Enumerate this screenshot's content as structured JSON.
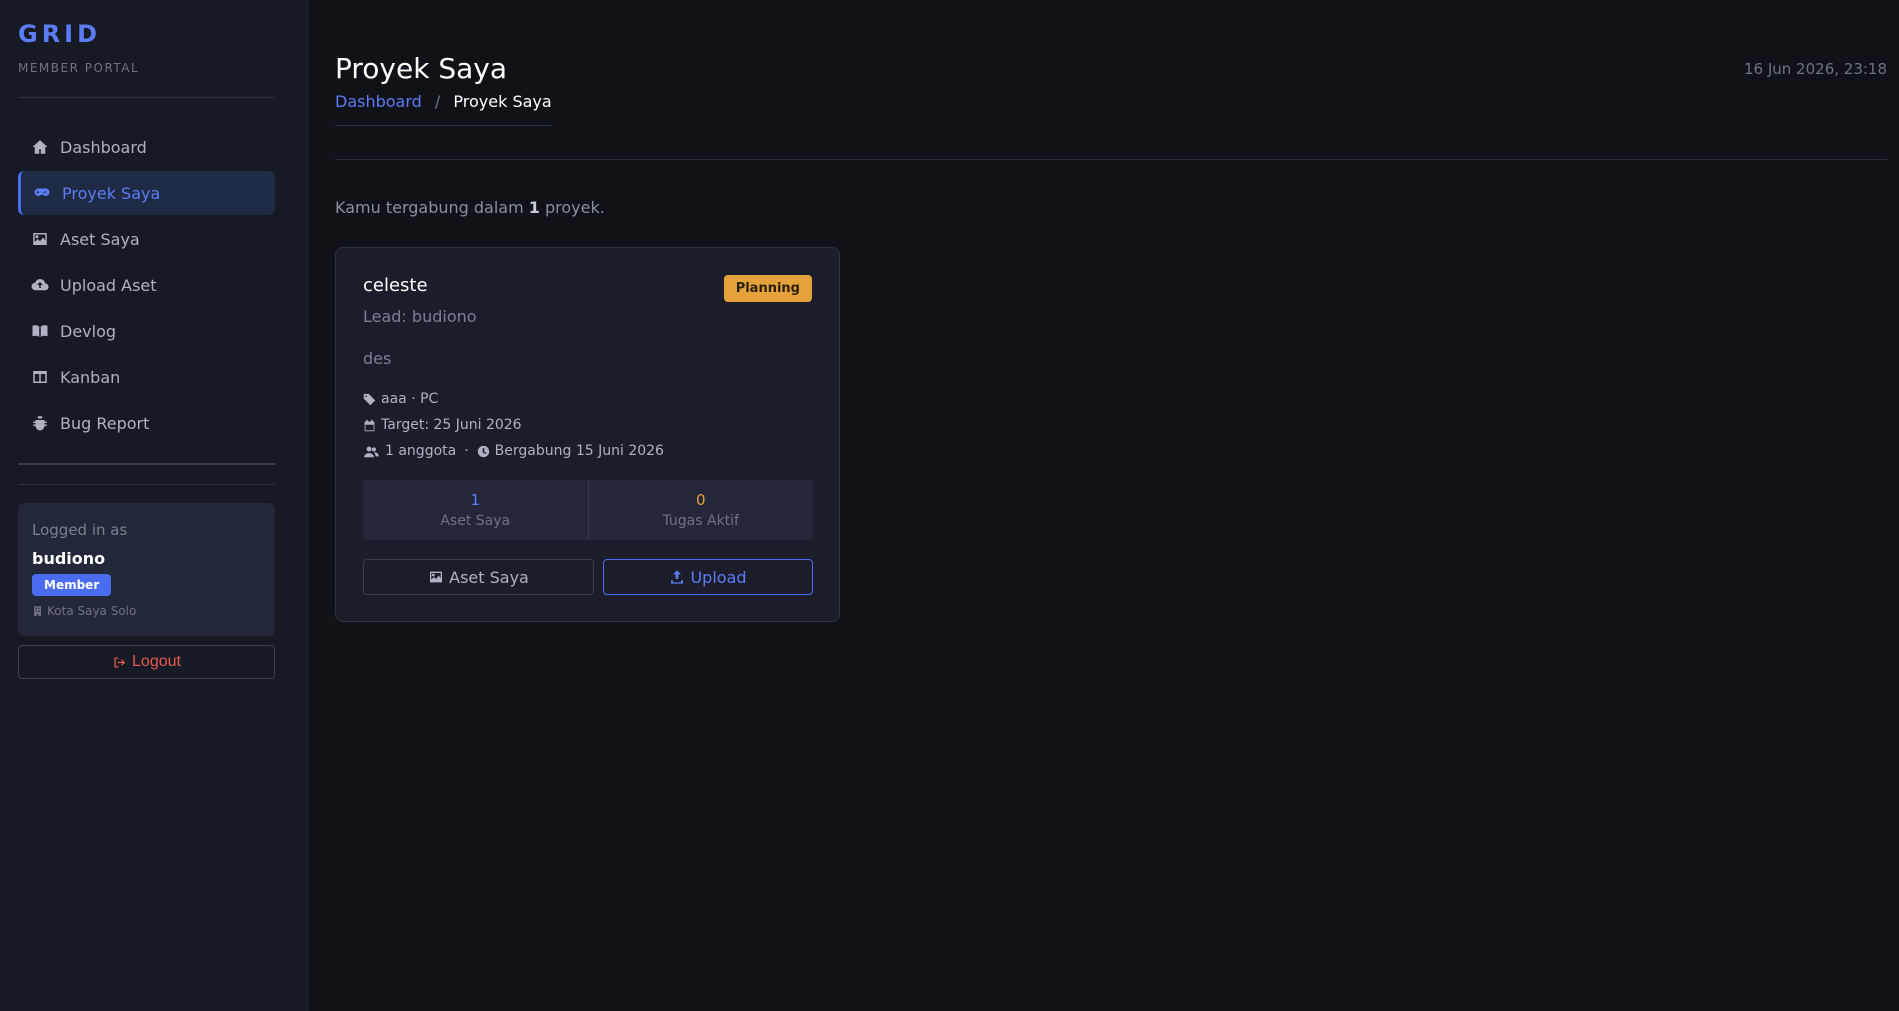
{
  "sidebar": {
    "brand": "GRID",
    "brand_sub": "MEMBER PORTAL",
    "items": [
      {
        "label": "Dashboard",
        "icon": "home-icon"
      },
      {
        "label": "Proyek Saya",
        "icon": "gamepad-icon",
        "active": true
      },
      {
        "label": "Aset Saya",
        "icon": "image-icon"
      },
      {
        "label": "Upload Aset",
        "icon": "cloud-upload-icon"
      },
      {
        "label": "Devlog",
        "icon": "book-icon"
      },
      {
        "label": "Kanban",
        "icon": "columns-icon"
      },
      {
        "label": "Bug Report",
        "icon": "bug-icon"
      }
    ],
    "user": {
      "logged_label": "Logged in as",
      "username": "budiono",
      "role": "Member",
      "city": "Kota Saya Solo"
    },
    "logout_label": "Logout"
  },
  "header": {
    "title": "Proyek Saya",
    "breadcrumb_root": "Dashboard",
    "breadcrumb_sep": "/",
    "breadcrumb_current": "Proyek Saya",
    "timestamp": "16 Jun 2026, 23:18"
  },
  "summary": {
    "prefix": "Kamu tergabung dalam ",
    "count": "1",
    "suffix": " proyek."
  },
  "project": {
    "name": "celeste",
    "status": "Planning",
    "lead": "Lead: budiono",
    "description": "des",
    "tags": "aaa · PC",
    "target": "Target: 25 Juni 2026",
    "members": "1 anggota",
    "joined": "Bergabung 15 Juni 2026",
    "stats": [
      {
        "value": "1",
        "label": "Aset Saya",
        "color": "#5b7cf5"
      },
      {
        "value": "0",
        "label": "Tugas Aktif",
        "color": "#e5a23a"
      }
    ],
    "btn_assets": "Aset Saya",
    "btn_upload": "Upload"
  },
  "colors": {
    "accent": "#4a6cf0",
    "planning": "#e5a23a",
    "danger": "#e8594f"
  }
}
